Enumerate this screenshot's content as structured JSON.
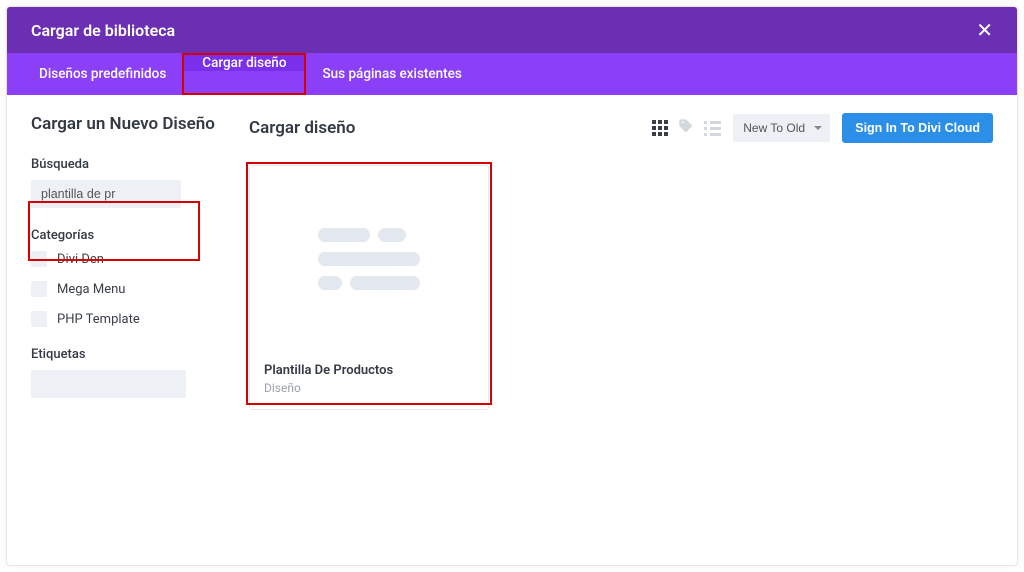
{
  "modal": {
    "title": "Cargar de biblioteca",
    "tabs": [
      {
        "label": "Diseños predefinidos",
        "active": false
      },
      {
        "label": "Cargar diseño",
        "active": true
      },
      {
        "label": "Sus páginas existentes",
        "active": false
      }
    ]
  },
  "sidebar": {
    "title": "Cargar un Nuevo Diseño",
    "search_label": "Búsqueda",
    "search_value": "plantilla de pr",
    "categories_label": "Categorías",
    "categories": [
      {
        "label": "Divi Den"
      },
      {
        "label": "Mega Menu"
      },
      {
        "label": "PHP Template"
      }
    ],
    "tags_label": "Etiquetas"
  },
  "main": {
    "title": "Cargar diseño",
    "sort_value": "New To Old",
    "signin_label": "Sign In To Divi Cloud",
    "card": {
      "name": "Plantilla De Productos",
      "type": "Diseño"
    }
  }
}
